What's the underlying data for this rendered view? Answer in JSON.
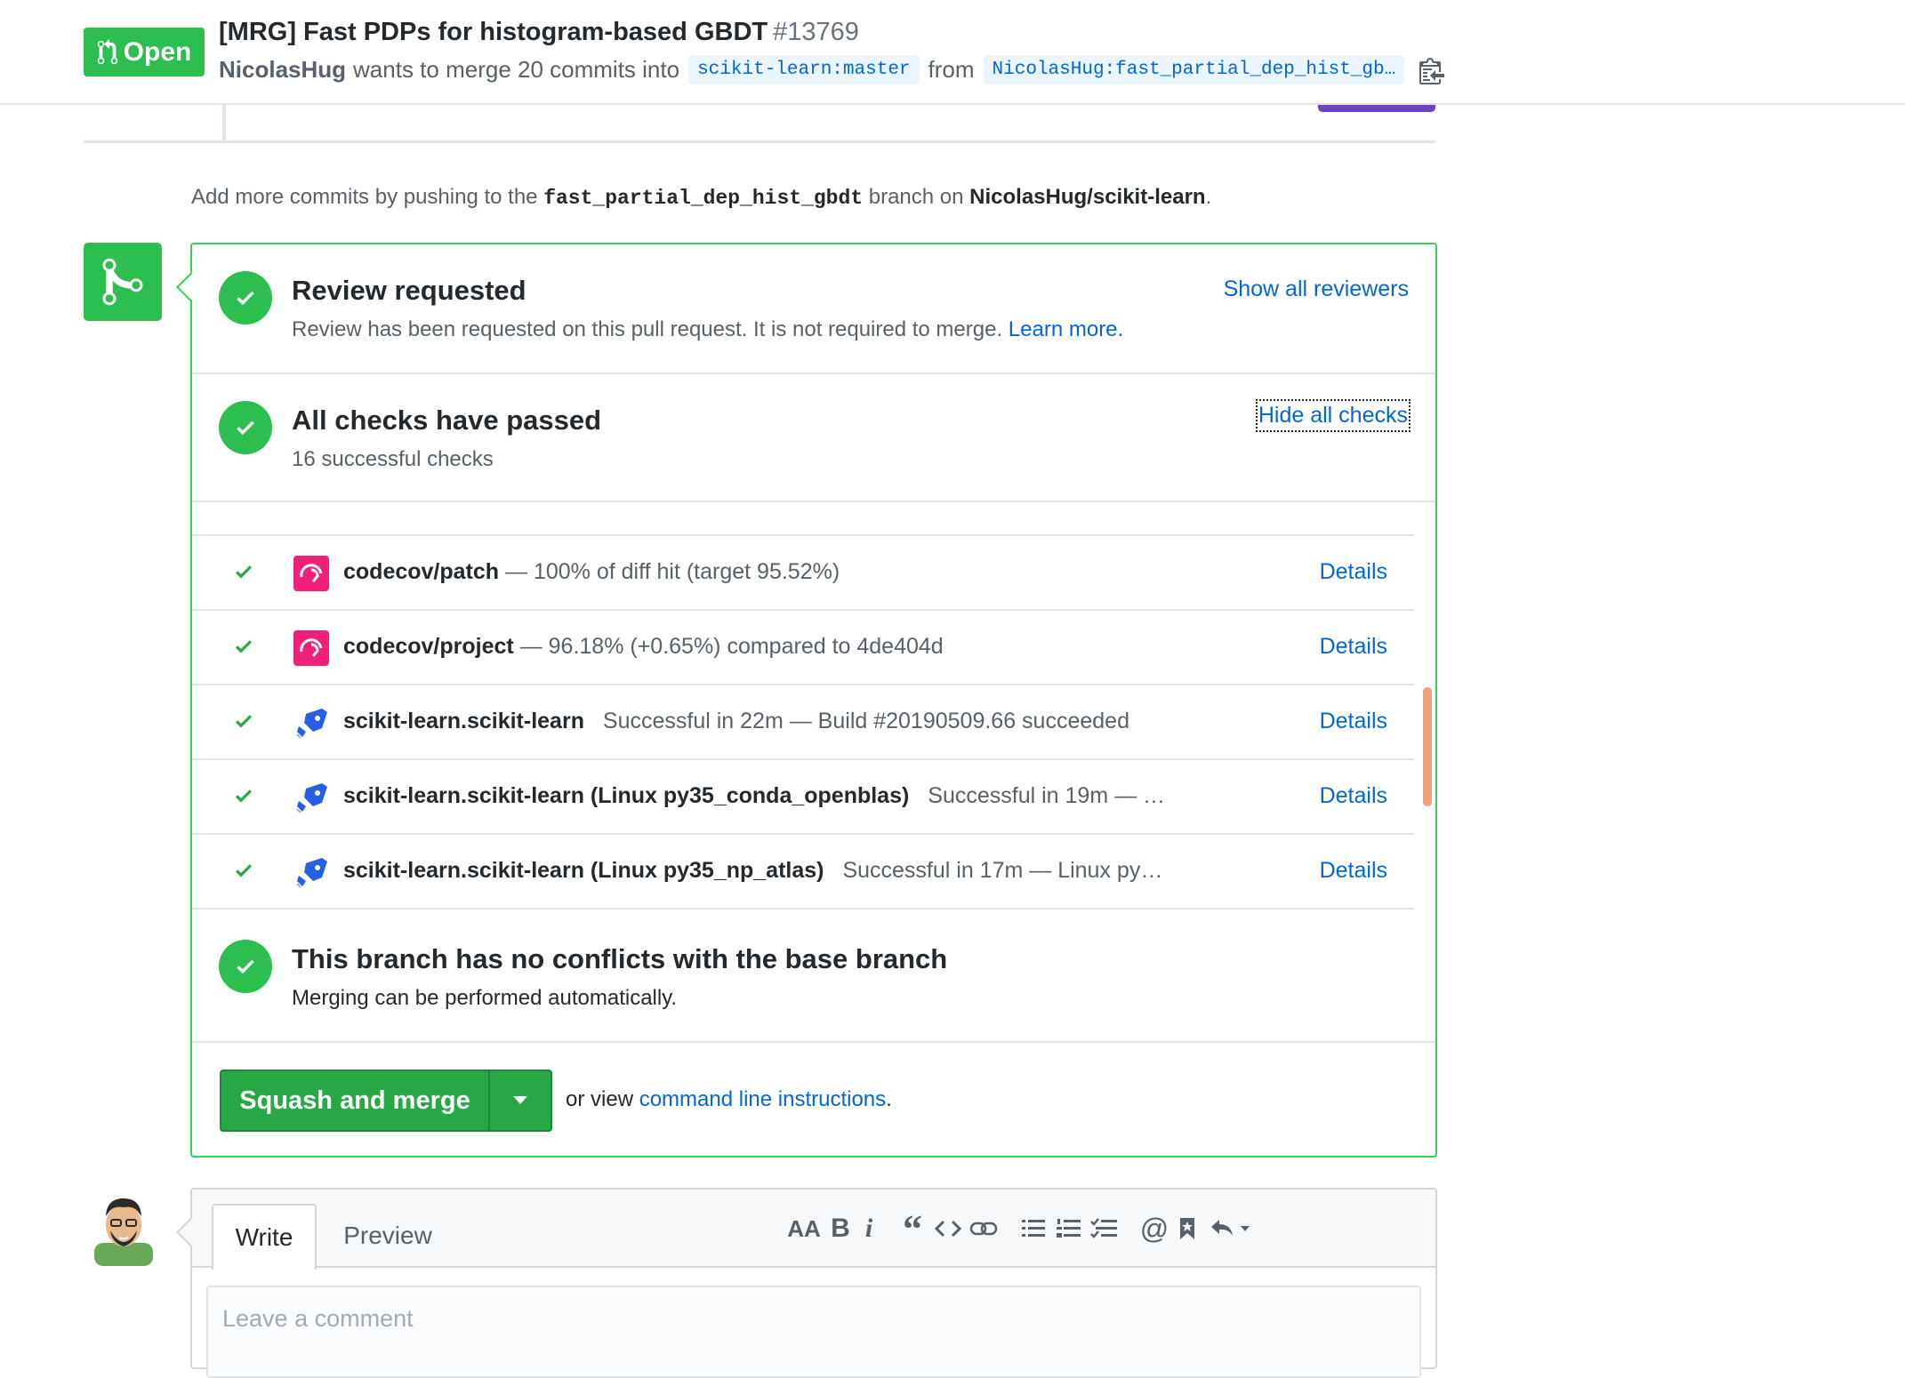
{
  "header": {
    "state": "Open",
    "title": "[MRG] Fast PDPs for histogram-based GBDT",
    "number": "#13769",
    "author": "NicolasHug",
    "merge_text": "wants to merge 20 commits into",
    "base_branch": "scikit-learn:master",
    "from_text": "from",
    "head_branch": "NicolasHug:fast_partial_dep_hist_gb…"
  },
  "add_commits": {
    "prefix": "Add more commits by pushing to the",
    "branch": "fast_partial_dep_hist_gbdt",
    "middle": "branch on",
    "repo": "NicolasHug/scikit-learn",
    "suffix": "."
  },
  "review": {
    "title": "Review requested",
    "subtitle": "Review has been requested on this pull request. It is not required to merge.",
    "learn_more": "Learn more.",
    "show_reviewers": "Show all reviewers"
  },
  "checks": {
    "title": "All checks have passed",
    "subtitle": "16 successful checks",
    "hide_link": "Hide all checks",
    "rows": [
      {
        "name": "codecov/patch",
        "desc": "— 100% of diff hit (target 95.52%)",
        "details": "Details",
        "icon": "codecov-icon"
      },
      {
        "name": "codecov/project",
        "desc": "— 96.18% (+0.65%) compared to 4de404d",
        "details": "Details",
        "icon": "codecov-icon"
      },
      {
        "name": "scikit-learn.scikit-learn",
        "desc": "Successful in 22m — Build #20190509.66 succeeded",
        "details": "Details",
        "icon": "azure-pipelines-icon"
      },
      {
        "name": "scikit-learn.scikit-learn (Linux py35_conda_openblas)",
        "desc": "Successful in 19m — …",
        "details": "Details",
        "icon": "azure-pipelines-icon"
      },
      {
        "name": "scikit-learn.scikit-learn (Linux py35_np_atlas)",
        "desc": "Successful in 17m — Linux py…",
        "details": "Details",
        "icon": "azure-pipelines-icon"
      }
    ]
  },
  "conflicts": {
    "title": "This branch has no conflicts with the base branch",
    "subtitle": "Merging can be performed automatically."
  },
  "merge": {
    "button": "Squash and merge",
    "or_view": "or view",
    "cli_link": "command line instructions",
    "period": "."
  },
  "comment": {
    "tab_write": "Write",
    "tab_preview": "Preview",
    "placeholder": "Leave a comment"
  },
  "colors": {
    "success": "#2cbe4e",
    "link": "#0366d6",
    "merge_button": "#28a745"
  }
}
